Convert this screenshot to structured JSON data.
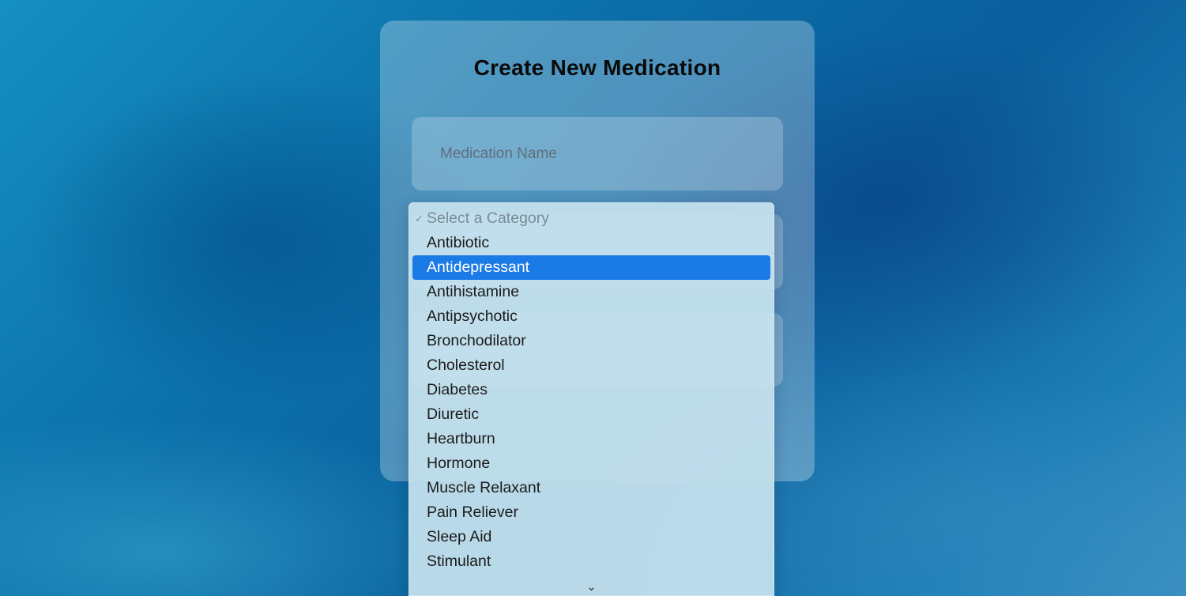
{
  "form": {
    "title": "Create New Medication",
    "name_placeholder": "Medication Name"
  },
  "category_select": {
    "placeholder": "Select a Category",
    "selected_value": "Antidepressant",
    "options": [
      "Select a Category",
      "Antibiotic",
      "Antidepressant",
      "Antihistamine",
      "Antipsychotic",
      "Bronchodilator",
      "Cholesterol",
      "Diabetes",
      "Diuretic",
      "Heartburn",
      "Hormone",
      "Muscle Relaxant",
      "Pain Reliever",
      "Sleep Aid",
      "Stimulant"
    ],
    "check_glyph": "✓",
    "scroll_down_glyph": "⌄"
  },
  "icons": {
    "check": "checkmark-icon",
    "scroll_down": "chevron-down-icon",
    "select_chevron": "chevron-down-icon"
  },
  "colors": {
    "highlight": "#1a7ae6",
    "title_text": "#0a0a0a"
  }
}
